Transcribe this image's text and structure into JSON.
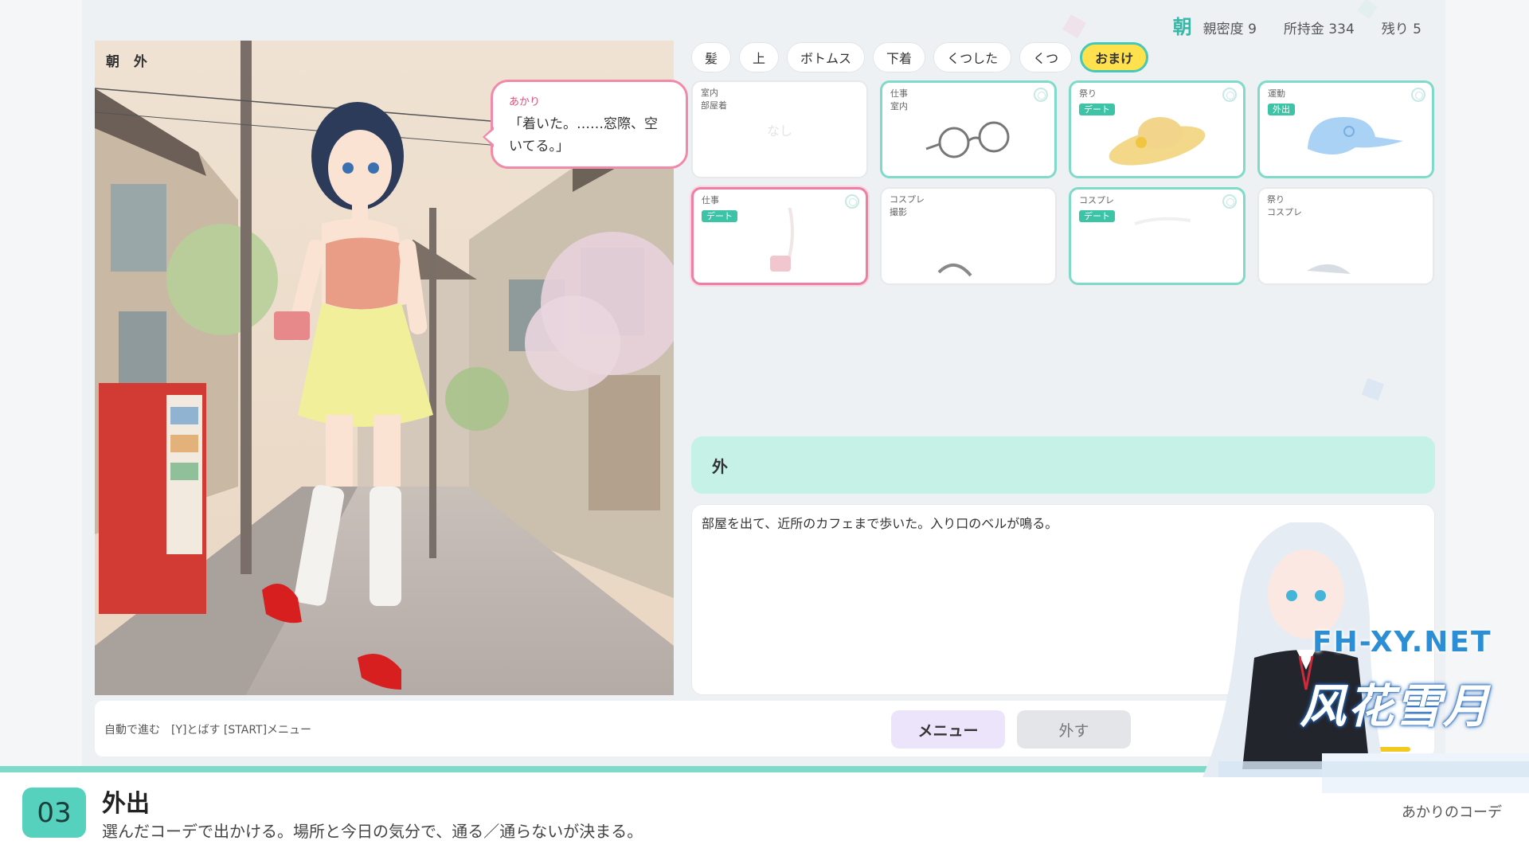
{
  "status": {
    "time_of_day": "朝",
    "intimacy": "親密度 9",
    "money": "所持金 334",
    "remaining": "残り 5"
  },
  "scene": {
    "label": "朝 外",
    "speaker": "あかり",
    "dialogue": "「着いた。……窓際、空いてる。」"
  },
  "tabs": [
    "髪",
    "上",
    "ボトムス",
    "下着",
    "くつした",
    "くつ",
    "おまけ"
  ],
  "active_tab": "おまけ",
  "items": [
    {
      "tag1": "室内",
      "tag2": "部屋着",
      "badge": "",
      "placeholder": "なし",
      "state": "plain",
      "icon": "none-icon"
    },
    {
      "tag1": "仕事",
      "tag2": "室内",
      "badge": "",
      "placeholder": "",
      "state": "owned",
      "icon": "glasses-icon"
    },
    {
      "tag1": "祭り",
      "tag2": "",
      "badge": "デート",
      "placeholder": "",
      "state": "owned",
      "icon": "sun-hat-icon"
    },
    {
      "tag1": "運動",
      "tag2": "",
      "badge": "外出",
      "placeholder": "",
      "state": "owned",
      "icon": "cap-icon"
    },
    {
      "tag1": "仕事",
      "tag2": "",
      "badge": "デート",
      "placeholder": "",
      "state": "equipped",
      "icon": "shoulder-bag-icon"
    },
    {
      "tag1": "コスプレ",
      "tag2": "撮影",
      "badge": "",
      "placeholder": "",
      "state": "plain",
      "icon": "cat-ears-headband-icon"
    },
    {
      "tag1": "コスプレ",
      "tag2": "",
      "badge": "デート",
      "placeholder": "",
      "state": "owned",
      "icon": "ribbon-icon"
    },
    {
      "tag1": "祭り",
      "tag2": "コスプレ",
      "badge": "",
      "placeholder": "",
      "state": "plain",
      "icon": "animal-ears-icon"
    }
  ],
  "location": {
    "name": "外"
  },
  "narration": {
    "text": "部屋を出て、近所のカフェまで歩いた。入り口のベルが鳴る。"
  },
  "controls": {
    "hint": "自動で進む　[Y]とばす [START]メニュー",
    "menu_label": "メニュー",
    "remove_label": "外す"
  },
  "footer": {
    "step": "03",
    "title": "外出",
    "description": "選んだコーデで出かける。場所と今日の気分で、通る／通らないが決まる。",
    "right": "あかりのコーデ"
  },
  "watermark": {
    "url": "FH-XY.NET",
    "text": "风花雪月"
  },
  "colors": {
    "accent_teal": "#55d1bd",
    "equipped_pink": "#ec7fa2",
    "active_yellow": "#ffe14d",
    "location_bg": "#c5f1e6"
  }
}
